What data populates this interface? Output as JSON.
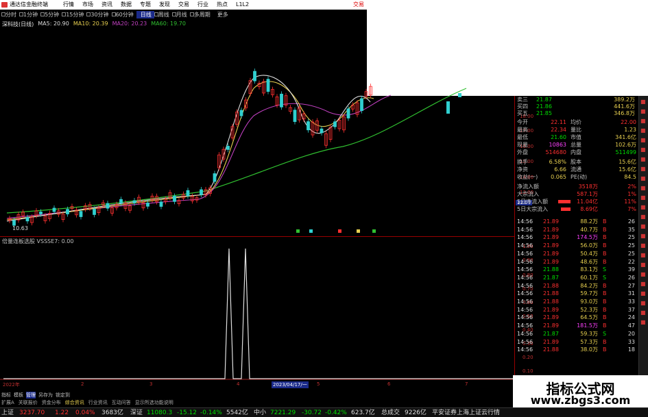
{
  "app": {
    "title": "通达信金融终端",
    "menu": [
      "行情",
      "市场",
      "资讯",
      "数据",
      "专题",
      "发现",
      "交易",
      "行业",
      "热点",
      "L1L2"
    ],
    "brand": "交易"
  },
  "periods": {
    "items": [
      "分时",
      "1分钟",
      "5分钟",
      "15分钟",
      "30分钟",
      "60分钟",
      "日线",
      "周线",
      "月线",
      "多周期",
      "更多"
    ],
    "selected": "日线"
  },
  "chart": {
    "stock_label": "深科技(日线)",
    "ma5": "MA5: 20.90",
    "ma10": "MA10: 20.39",
    "ma20": "MA20: 20.23",
    "ma60": "MA60: 19.70",
    "low_label": "10.63",
    "price_label": "12.01",
    "indicator_label": "倍量连板选股 VSSSE7: 0.00",
    "date_label": "2023/04/17/一",
    "axis_ticks": [
      "2022年",
      "2",
      "3",
      "4",
      "5",
      "6",
      "7"
    ],
    "price_axis": [
      "18.00",
      "17.00",
      "16.00",
      "15.00",
      "14.00",
      "13.00"
    ],
    "ind_axis": [
      "1.00",
      "0.90",
      "0.80",
      "0.70",
      "0.60",
      "0.50",
      "0.40",
      "0.30",
      "0.20",
      "0.10"
    ],
    "colors": {
      "up": "#ff3030",
      "down": "#30d0d0",
      "ma5": "#e0e0e0",
      "ma10": "#e8d050",
      "ma20": "#c040c0",
      "ma60": "#30c030"
    }
  },
  "quote": {
    "asks": [
      {
        "label": "卖三",
        "price": "21.87",
        "vol": "389.2万"
      },
      {
        "label": "买四",
        "price": "21.86",
        "vol": "441.6万"
      },
      {
        "label": "买五",
        "price": "21.85",
        "vol": "346.8万"
      }
    ],
    "stats": [
      {
        "l1": "今开",
        "v1": "22.11",
        "l2": "均价",
        "v2": "22.00"
      },
      {
        "l1": "最高",
        "v1": "22.34",
        "l2": "量比",
        "v2": "1.23"
      },
      {
        "l1": "最低",
        "v1": "21.60",
        "l2": "市值",
        "v2": "341.6亿"
      },
      {
        "l1": "现量",
        "v1": "10863",
        "l2": "总量",
        "v2": "102.6万"
      },
      {
        "l1": "外盘",
        "v1": "514680",
        "l2": "内盘",
        "v2": "511499"
      },
      {
        "l1": "换手",
        "v1": "6.58%",
        "l2": "股本",
        "v2": "15.6亿"
      },
      {
        "l1": "净资",
        "v1": "6.66",
        "l2": "流通",
        "v2": "15.6亿"
      },
      {
        "l1": "收益(一)",
        "v1": "0.065",
        "l2": "PE(动)",
        "v2": "84.5"
      }
    ],
    "flows": [
      {
        "label": "净流入额",
        "value": "3518万",
        "pct": "2%"
      },
      {
        "label": "大宗流入",
        "value": "587.1万",
        "pct": "1%"
      },
      {
        "label": "5日净流入额",
        "value": "11.04亿",
        "pct": "11%"
      },
      {
        "label": "5日大宗流入",
        "value": "8.69亿",
        "pct": "7%"
      }
    ],
    "trades": [
      {
        "t": "14:56",
        "p": "21.89",
        "q": "88.2万",
        "s": "B",
        "n": "26"
      },
      {
        "t": "14:56",
        "p": "21.89",
        "q": "40.7万",
        "s": "B",
        "n": "35"
      },
      {
        "t": "14:56",
        "p": "21.89",
        "q": "174.5万",
        "s": "B",
        "n": "25"
      },
      {
        "t": "14:56",
        "p": "21.89",
        "q": "56.0万",
        "s": "B",
        "n": "25"
      },
      {
        "t": "14:56",
        "p": "21.89",
        "q": "50.4万",
        "s": "B",
        "n": "25"
      },
      {
        "t": "14:56",
        "p": "21.89",
        "q": "48.6万",
        "s": "B",
        "n": "22"
      },
      {
        "t": "14:56",
        "p": "21.88",
        "q": "83.1万",
        "s": "S",
        "n": "39"
      },
      {
        "t": "14:56",
        "p": "21.87",
        "q": "60.1万",
        "s": "S",
        "n": "26"
      },
      {
        "t": "14:56",
        "p": "21.88",
        "q": "84.2万",
        "s": "B",
        "n": "27"
      },
      {
        "t": "14:56",
        "p": "21.88",
        "q": "59.7万",
        "s": "B",
        "n": "31"
      },
      {
        "t": "14:56",
        "p": "21.88",
        "q": "93.0万",
        "s": "B",
        "n": "33"
      },
      {
        "t": "14:56",
        "p": "21.89",
        "q": "52.3万",
        "s": "B",
        "n": "37"
      },
      {
        "t": "14:56",
        "p": "21.89",
        "q": "64.5万",
        "s": "B",
        "n": "24"
      },
      {
        "t": "14:56",
        "p": "21.89",
        "q": "181.5万",
        "s": "B",
        "n": "47"
      },
      {
        "t": "14:56",
        "p": "21.87",
        "q": "59.3万",
        "s": "S",
        "n": "20"
      },
      {
        "t": "14:56",
        "p": "21.89",
        "q": "57.3万",
        "s": "B",
        "n": "33"
      },
      {
        "t": "14:56",
        "p": "21.88",
        "q": "38.0万",
        "s": "B",
        "n": "18"
      }
    ]
  },
  "tabs": {
    "row1": [
      "指标",
      "模板",
      "管理",
      "另存为",
      "锁定到"
    ],
    "row1_selected": "管理",
    "row2": [
      "扩展A",
      "关联报价",
      "资金分布",
      "综合资讯",
      "行业资讯",
      "互动问答",
      "显示所选功能说明"
    ]
  },
  "status": {
    "sh_label": "上证",
    "sh_val": "3237.70",
    "sh_chg": "1.22",
    "sh_pct": "0.04%",
    "sh_amt": "3683亿",
    "sz_label": "深证",
    "sz_val": "11080.3",
    "sz_chg": "-15.12",
    "sz_pct": "-0.14%",
    "sz_amt": "5542亿",
    "zx_label": "中小",
    "zx_val": "7221.29",
    "zx_chg": "-30.72",
    "zx_pct": "-0.42%",
    "zx_amt": "623.7亿",
    "total_label": "总成交",
    "total_amt": "9226亿",
    "broker": "平安证券上海上证云行情"
  },
  "watermark": {
    "line1": "指标公式网",
    "line2": "www.zbgs3.com"
  }
}
